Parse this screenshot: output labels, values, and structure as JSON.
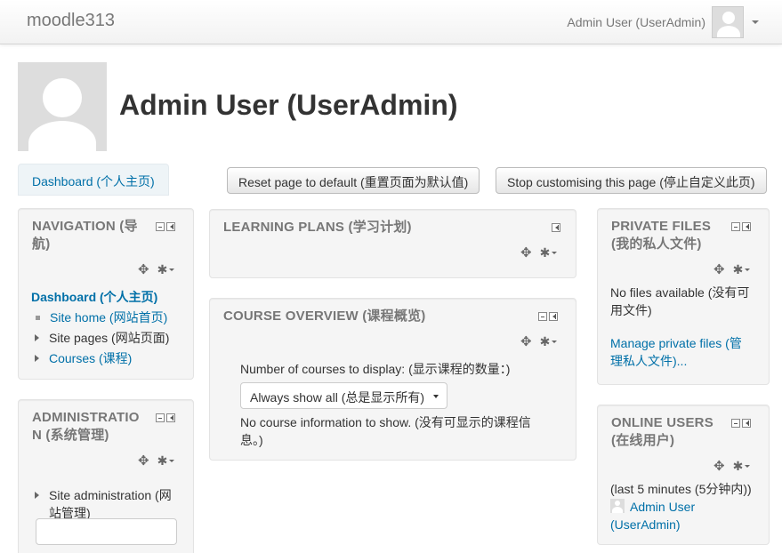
{
  "navbar": {
    "brand": "moodle313",
    "user_name": "Admin User (UserAdmin)"
  },
  "header": {
    "title": "Admin User (UserAdmin)"
  },
  "dashboard_tab": "Dashboard (个人主页)",
  "buttons": {
    "reset": "Reset page to default (重置页面为默认值)",
    "stop": "Stop customising this page (停止自定义此页)"
  },
  "navigation": {
    "title_line1": "NAVIGATION (导",
    "title_line2": "航)",
    "dashboard": "Dashboard (个人主页)",
    "site_home": "Site home (网站首页)",
    "site_pages": "Site pages (网站页面)",
    "courses": "Courses (课程)"
  },
  "administration": {
    "title_line1": "ADMINISTRATIO",
    "title_line2": "N (系统管理)",
    "site_admin_line1": "Site administration (网",
    "site_admin_line2": "站管理)"
  },
  "learning_plans": {
    "title": "LEARNING PLANS (学习计划)"
  },
  "course_overview": {
    "title": "COURSE OVERVIEW (课程概览)",
    "num_label": "Number of courses to display: (显示课程的数量：)",
    "select_value": "Always show all (总是显示所有)",
    "no_info_line1": "No course information to show. (没有可显示的课程信",
    "no_info_line2": "息。)"
  },
  "private_files": {
    "title_line1": "PRIVATE FILES",
    "title_line2": "(我的私人文件)",
    "no_files_line1": "No files available (没有可",
    "no_files_line2": "用文件)",
    "manage_line1": "Manage private files (管",
    "manage_line2": "理私人文件)..."
  },
  "online_users": {
    "title_line1": "ONLINE USERS",
    "title_line2": "(在线用户)",
    "period": "(last 5 minutes (5分钟内))",
    "user_line1": "Admin User",
    "user_line2": "(UserAdmin)"
  },
  "icons": {
    "move": "move-icon",
    "gear": "gear-icon",
    "minimize": "minimize-icon",
    "dock": "dock-icon"
  }
}
